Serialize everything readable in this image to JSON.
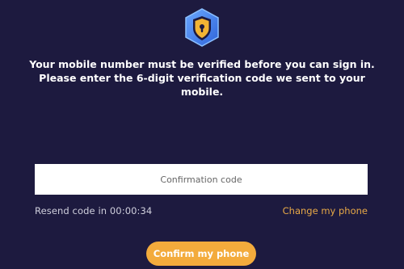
{
  "header": {
    "logo_icon": "shield-lock-icon"
  },
  "message": {
    "line1": "Your mobile number must be verified before you can sign in.",
    "line2": "Please enter the 6-digit verification code we sent to your",
    "line3": "mobile."
  },
  "code_input": {
    "placeholder": "Confirmation code",
    "value": ""
  },
  "resend": {
    "text": "Resend code in 00:00:34"
  },
  "change_phone": {
    "label": "Change my phone"
  },
  "confirm_button": {
    "label": "Confirm my phone"
  },
  "colors": {
    "background": "#1d1a3f",
    "accent": "#f3ab3c",
    "link": "#e8a947",
    "logo_blue": "#4f8ef0",
    "logo_lock": "#f2b433"
  }
}
